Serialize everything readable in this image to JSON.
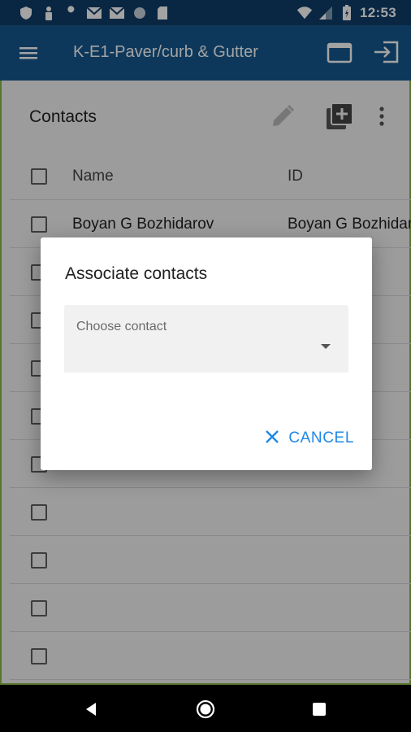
{
  "status_bar": {
    "time": "12:53",
    "icons_left": [
      "shield-icon",
      "person-icon",
      "wrench-icon",
      "mail-icon",
      "mail-icon",
      "circle-icon",
      "sd-card-icon"
    ],
    "icons_right": [
      "wifi-icon",
      "signal-icon",
      "battery-icon"
    ]
  },
  "app_bar": {
    "title": "K-E1-Paver/curb & Gutter",
    "icons": [
      "menu-icon",
      "window-icon",
      "exit-icon"
    ]
  },
  "contacts": {
    "title": "Contacts",
    "header": {
      "name": "Name",
      "id": "ID"
    },
    "rows": [
      {
        "name": "Boyan G Bozhidarov",
        "id": "Boyan G Bozhidarov"
      },
      {
        "name": "",
        "id": ""
      },
      {
        "name": "",
        "id": ""
      },
      {
        "name": "",
        "id": ""
      },
      {
        "name": "",
        "id": ""
      },
      {
        "name": "",
        "id": ""
      },
      {
        "name": "",
        "id": ""
      },
      {
        "name": "",
        "id": ""
      },
      {
        "name": "",
        "id": ""
      },
      {
        "name": "",
        "id": ""
      }
    ]
  },
  "dialog": {
    "title": "Associate contacts",
    "select_placeholder": "Choose contact",
    "cancel_label": "CANCEL"
  },
  "colors": {
    "status_bar": "#0f3e6a",
    "app_bar": "#15588f",
    "accent": "#1e88e5"
  }
}
